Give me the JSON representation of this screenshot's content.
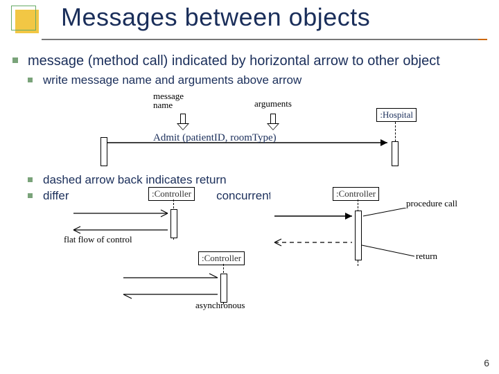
{
  "title": "Messages between objects",
  "bullets": {
    "main": "message (method call) indicated by horizontal arrow to other object",
    "sub1": "write message name and arguments above arrow",
    "sub2": "dashed arrow back indicates return",
    "sub3": "different arrowheads for normal / concurrent (asynchronous) methods"
  },
  "fig1": {
    "box_label": ":Hospital",
    "message_text": "Admit (patientID, roomType)",
    "annot_name": "message\nname",
    "annot_args": "arguments"
  },
  "fig2": {
    "box_label": ":Controller",
    "annot": "flat flow of control"
  },
  "fig3": {
    "box_label": ":Controller",
    "annot": "asynchronous"
  },
  "fig4": {
    "box_label": ":Controller",
    "annot_call": "procedure call",
    "annot_return": "return"
  },
  "page_number": "6"
}
